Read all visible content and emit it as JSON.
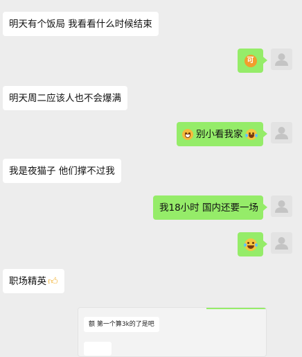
{
  "chat": {
    "messages": [
      {
        "side": "in",
        "text": "明天有个饭局 我看看什么时候结束"
      },
      {
        "side": "out",
        "text": "",
        "emoji": "可-emoji"
      },
      {
        "side": "in",
        "text": "明天周二应该人也不会爆满"
      },
      {
        "side": "out",
        "text": "别小看我家",
        "emoji_before": "grin-emoji",
        "emoji_after": "laugh-cry-emoji"
      },
      {
        "side": "in",
        "text": "我是夜猫子 他们撑不过我"
      },
      {
        "side": "out",
        "text": "我18小时 国内还要一场"
      },
      {
        "side": "out",
        "text": "",
        "emoji": "laugh-cry-emoji"
      },
      {
        "side": "in",
        "text": "职场精英",
        "emoji_after": "thumbs-up-emoji"
      }
    ],
    "ke_glyph": "可",
    "nested_screenshot": {
      "text": "额 第一个算3k的了是吧"
    }
  },
  "colors": {
    "background": "#ededed",
    "incoming_bubble": "#ffffff",
    "outgoing_bubble": "#95ec69"
  }
}
